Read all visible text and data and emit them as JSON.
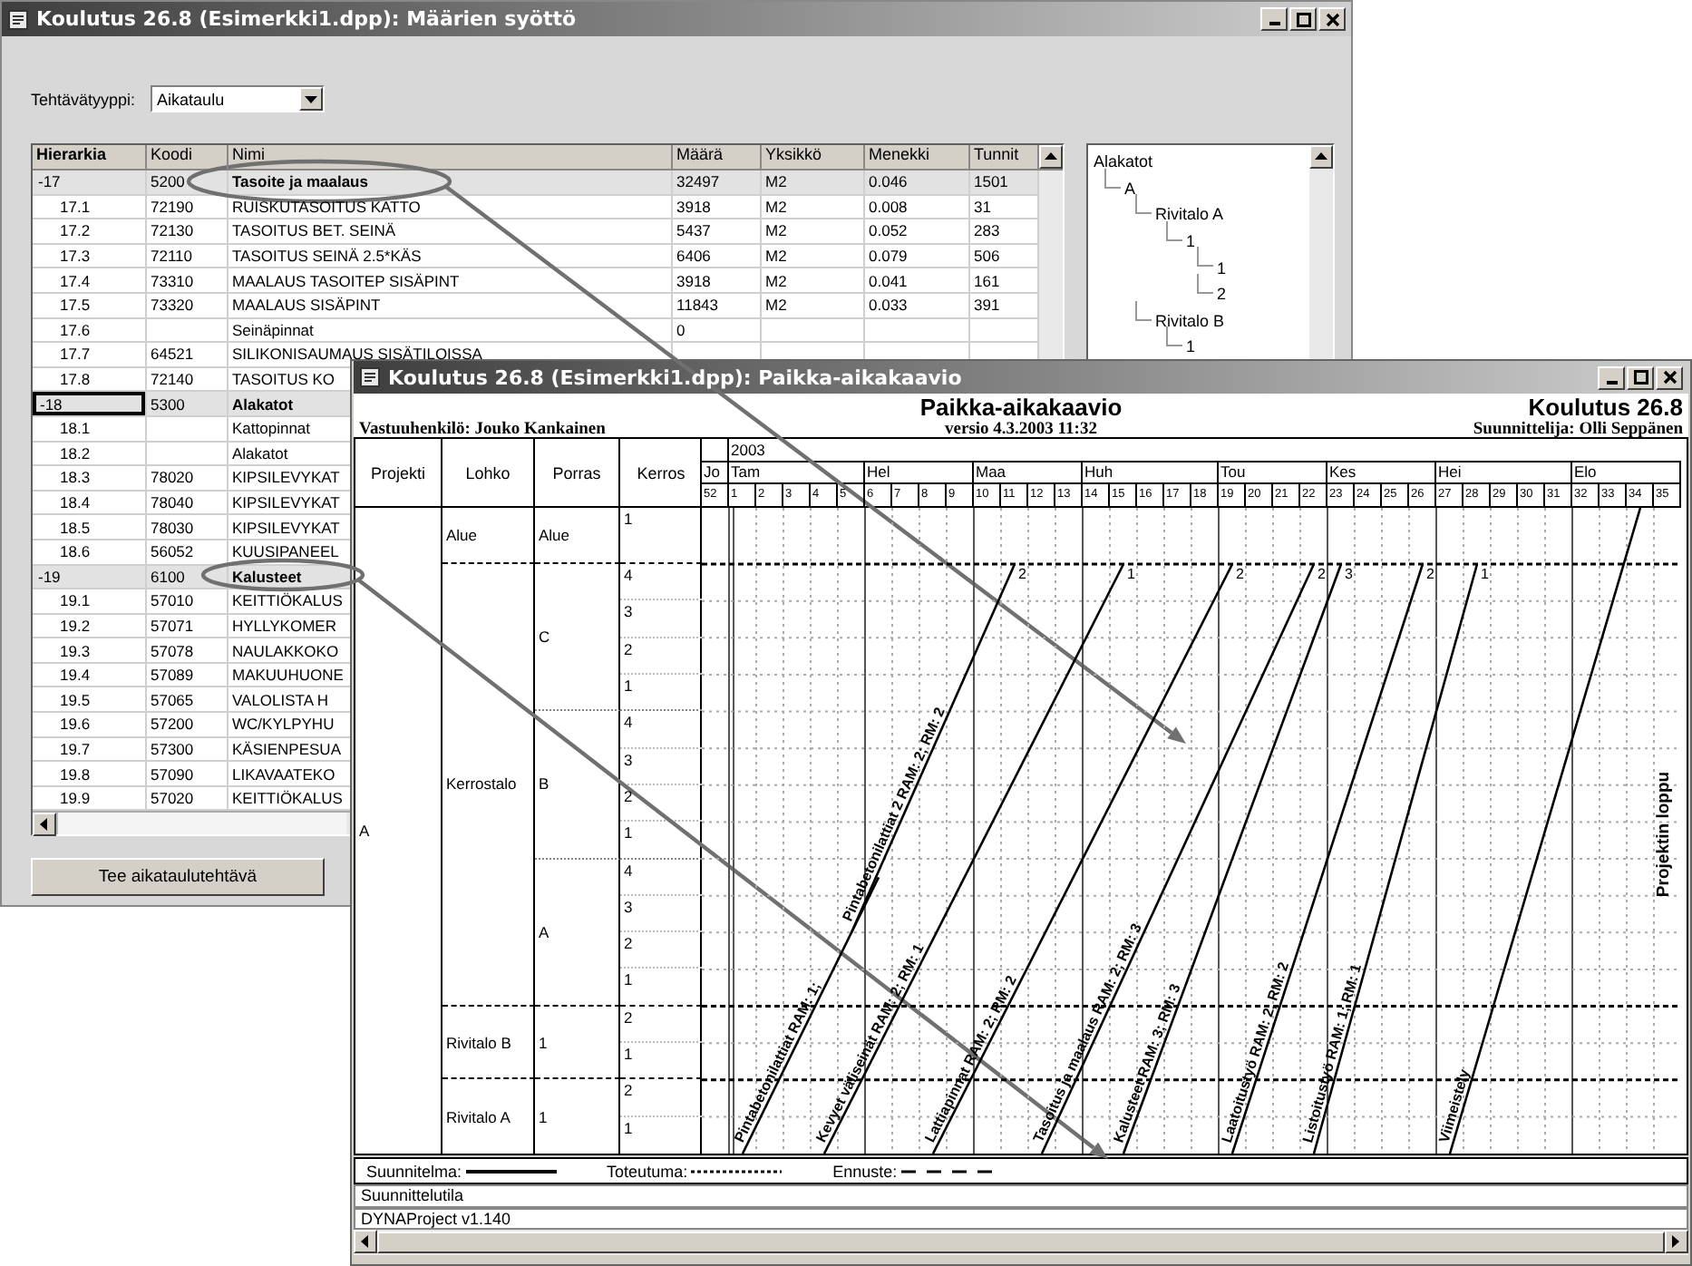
{
  "entry_window": {
    "title": "Koulutus 26.8 (Esimerkki1.dpp): Määrien syöttö",
    "task_type": {
      "label": "Tehtävätyyppi:",
      "value": "Aikataulu"
    },
    "table": {
      "columns": [
        "Hierarkia",
        "Koodi",
        "Nimi",
        "Määrä",
        "Yksikkö",
        "Menekki",
        "Tunnit"
      ],
      "rows": [
        {
          "kind": "group",
          "selected": false,
          "hierarchy": "-17",
          "code": "5200",
          "name": "Tasoite ja maalaus",
          "quantity": "32497",
          "unit": "M2",
          "usage": "0.046",
          "hours": "1501"
        },
        {
          "kind": "item",
          "selected": false,
          "hierarchy": "17.1",
          "code": "72190",
          "name": "RUISKUTASOITUS KATTO",
          "quantity": "3918",
          "unit": "M2",
          "usage": "0.008",
          "hours": "31"
        },
        {
          "kind": "item",
          "selected": false,
          "hierarchy": "17.2",
          "code": "72130",
          "name": "TASOITUS BET. SEINÄ",
          "quantity": "5437",
          "unit": "M2",
          "usage": "0.052",
          "hours": "283"
        },
        {
          "kind": "item",
          "selected": false,
          "hierarchy": "17.3",
          "code": "72110",
          "name": "TASOITUS SEINÄ 2.5*KÄS",
          "quantity": "6406",
          "unit": "M2",
          "usage": "0.079",
          "hours": "506"
        },
        {
          "kind": "item",
          "selected": false,
          "hierarchy": "17.4",
          "code": "73310",
          "name": "MAALAUS TASOITEP  SISÄPINT",
          "quantity": "3918",
          "unit": "M2",
          "usage": "0.041",
          "hours": "161"
        },
        {
          "kind": "item",
          "selected": false,
          "hierarchy": "17.5",
          "code": "73320",
          "name": "MAALAUS SISÄPINT",
          "quantity": "11843",
          "unit": "M2",
          "usage": "0.033",
          "hours": "391"
        },
        {
          "kind": "item",
          "selected": false,
          "hierarchy": "17.6",
          "name": "Seinäpinnat",
          "quantity": "0"
        },
        {
          "kind": "item",
          "selected": false,
          "hierarchy": "17.7",
          "code": "64521",
          "name": "SILIKONISAUMAUS SISÄTILOISSA"
        },
        {
          "kind": "item",
          "selected": false,
          "hierarchy": "17.8",
          "code": "72140",
          "name": "TASOITUS KO"
        },
        {
          "kind": "group",
          "selected": true,
          "hierarchy": "-18",
          "code": "5300",
          "name": "Alakatot"
        },
        {
          "kind": "item",
          "selected": false,
          "hierarchy": "18.1",
          "name": "Kattopinnat"
        },
        {
          "kind": "item",
          "selected": false,
          "hierarchy": "18.2",
          "name": "Alakatot"
        },
        {
          "kind": "item",
          "selected": false,
          "hierarchy": "18.3",
          "code": "78020",
          "name": "KIPSILEVYKAT"
        },
        {
          "kind": "item",
          "selected": false,
          "hierarchy": "18.4",
          "code": "78040",
          "name": "KIPSILEVYKAT"
        },
        {
          "kind": "item",
          "selected": false,
          "hierarchy": "18.5",
          "code": "78030",
          "name": "KIPSILEVYKAT"
        },
        {
          "kind": "item",
          "selected": false,
          "hierarchy": "18.6",
          "code": "56052",
          "name": "KUUSIPANEEL"
        },
        {
          "kind": "group",
          "selected": false,
          "hierarchy": "-19",
          "code": "6100",
          "name": "Kalusteet"
        },
        {
          "kind": "item",
          "selected": false,
          "hierarchy": "19.1",
          "code": "57010",
          "name": "KEITTIÖKALUS"
        },
        {
          "kind": "item",
          "selected": false,
          "hierarchy": "19.2",
          "code": "57071",
          "name": "HYLLYKOMER"
        },
        {
          "kind": "item",
          "selected": false,
          "hierarchy": "19.3",
          "code": "57078",
          "name": "NAULAKKOKO"
        },
        {
          "kind": "item",
          "selected": false,
          "hierarchy": "19.4",
          "code": "57089",
          "name": "MAKUUHUONE"
        },
        {
          "kind": "item",
          "selected": false,
          "hierarchy": "19.5",
          "code": "57065",
          "name": "VALOLISTA H"
        },
        {
          "kind": "item",
          "selected": false,
          "hierarchy": "19.6",
          "code": "57200",
          "name": "WC/KYLPYHU"
        },
        {
          "kind": "item",
          "selected": false,
          "hierarchy": "19.7",
          "code": "57300",
          "name": "KÄSIENPESUA"
        },
        {
          "kind": "item",
          "selected": false,
          "hierarchy": "19.8",
          "code": "57090",
          "name": "LIKAVAATEKO"
        },
        {
          "kind": "item",
          "selected": false,
          "hierarchy": "19.9",
          "code": "57020",
          "name": "KEITTIÖKALUS"
        }
      ]
    },
    "tree": {
      "label": "Alakatot",
      "children": [
        {
          "label": "A",
          "children": [
            {
              "label": "Rivitalo A",
              "children": [
                {
                  "label": "1",
                  "children": [
                    {
                      "label": "1"
                    },
                    {
                      "label": "2"
                    }
                  ]
                }
              ]
            },
            {
              "label": "Rivitalo B",
              "children": [
                {
                  "label": "1"
                }
              ]
            }
          ]
        }
      ]
    },
    "button": "Tee aikataulutehtävä"
  },
  "chart_window": {
    "title": "Koulutus 26.8 (Esimerkki1.dpp): Paikka-aikakaavio",
    "heading": "Paikka-aikakaavio",
    "version": "versio 4.3.2003 11:32",
    "owner": "Vastuuhenkilö: Jouko Kankainen",
    "project": "Koulutus 26.8",
    "planner": "Suunnittelija: Olli Seppänen",
    "columns": [
      "Projekti",
      "Lohko",
      "Porras",
      "Kerros"
    ],
    "locations": {
      "project": "A",
      "blocks": [
        {
          "name": "Alue",
          "stages": [
            {
              "name": "Alue",
              "floors": [
                "1"
              ]
            }
          ]
        },
        {
          "name": "Kerrostalo",
          "stages": [
            {
              "name": "C",
              "floors": [
                "4",
                "3",
                "2",
                "1"
              ]
            },
            {
              "name": "B",
              "floors": [
                "4",
                "3",
                "2",
                "1"
              ]
            },
            {
              "name": "A",
              "floors": [
                "4",
                "3",
                "2",
                "1"
              ]
            }
          ]
        },
        {
          "name": "Rivitalo B",
          "stages": [
            {
              "name": "1",
              "floors": [
                "2",
                "1"
              ]
            }
          ]
        },
        {
          "name": "Rivitalo A",
          "stages": [
            {
              "name": "1",
              "floors": [
                "2",
                "1"
              ]
            }
          ]
        }
      ]
    },
    "timeline": {
      "year": "2003",
      "months": [
        {
          "label": "Jo",
          "weeks": [
            "52"
          ]
        },
        {
          "label": "Tam",
          "weeks": [
            "1",
            "2",
            "3",
            "4",
            "5"
          ]
        },
        {
          "label": "Hel",
          "weeks": [
            "6",
            "7",
            "8",
            "9"
          ]
        },
        {
          "label": "Maa",
          "weeks": [
            "10",
            "11",
            "12",
            "13"
          ]
        },
        {
          "label": "Huh",
          "weeks": [
            "14",
            "15",
            "16",
            "17",
            "18"
          ]
        },
        {
          "label": "Tou",
          "weeks": [
            "19",
            "20",
            "21",
            "22"
          ]
        },
        {
          "label": "Kes",
          "weeks": [
            "23",
            "24",
            "25",
            "26"
          ]
        },
        {
          "label": "Hei",
          "weeks": [
            "27",
            "28",
            "29",
            "30",
            "31"
          ]
        },
        {
          "label": "Elo",
          "weeks": [
            "32",
            "33",
            "34",
            "35"
          ]
        }
      ],
      "tasks": [
        {
          "label": "Pintabetonilattiat RAM: 1;"
        },
        {
          "label": "Pintabetonilattiat 2 RAM: 2; RM: 2",
          "end_label": "2"
        },
        {
          "label": "Kevyet väliseinät RAM: 2; RM: 1",
          "end_label": "1"
        },
        {
          "label": "Lattiapinnat RAM: 2; RM: 2",
          "end_label": "2"
        },
        {
          "label": "Tasoitus ja maalaus RAM: 2; RM: 3",
          "end_label": "2"
        },
        {
          "label": "Kalusteet RAM: 3; RM: 3",
          "end_label": "3"
        },
        {
          "label": "Laatoitustyö RAM: 2; RM: 2",
          "end_label": "2"
        },
        {
          "label": "Listoitustyö RAM: 1; RM: 1",
          "end_label": "1"
        },
        {
          "label": "Viimeistely"
        }
      ],
      "end_marker": "Projektin loppu"
    },
    "legend": [
      {
        "label": "Suunnitelma:",
        "kind": "solid"
      },
      {
        "label": "Toteutuma:",
        "kind": "dotted"
      },
      {
        "label": "Ennuste:",
        "kind": "dashed"
      }
    ],
    "status": "Suunnittelutila",
    "program": "DYNAProject v1.140"
  }
}
